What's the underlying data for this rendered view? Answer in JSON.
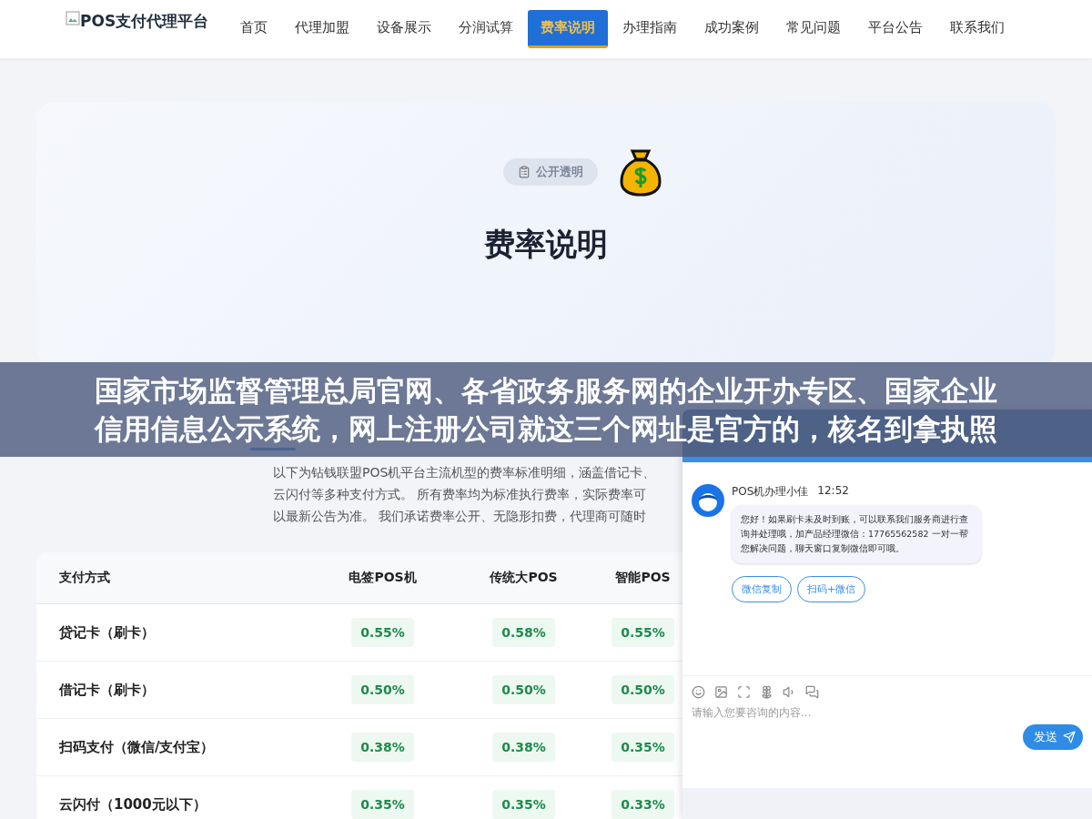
{
  "logo": {
    "alt": "POS支付代理平台"
  },
  "nav": [
    {
      "label": "首页",
      "selected": false
    },
    {
      "label": "代理加盟",
      "selected": false
    },
    {
      "label": "设备展示",
      "selected": false
    },
    {
      "label": "分润试算",
      "selected": false
    },
    {
      "label": "费率说明",
      "selected": true
    },
    {
      "label": "办理指南",
      "selected": false
    },
    {
      "label": "成功案例",
      "selected": false
    },
    {
      "label": "常见问题",
      "selected": false
    },
    {
      "label": "平台公告",
      "selected": false
    },
    {
      "label": "联系我们",
      "selected": false
    }
  ],
  "hero": {
    "badge": "公开透明",
    "title": "费率说明"
  },
  "intro": [
    "以下为钻钱联盟POS机平台主流机型的费率标准明细，涵盖借记卡、",
    "云闪付等多种支付方式。 所有费率均为标准执行费率，实际费率可",
    "以最新公告为准。 我们承诺费率公开、无隐形扣费，代理商可随时"
  ],
  "table": {
    "columns": [
      "支付方式",
      "电签POS机",
      "传统大POS",
      "智能POS"
    ],
    "rows": [
      {
        "method": "贷记卡（刷卡）",
        "rates": [
          "0.55%",
          "0.58%",
          "0.55%"
        ]
      },
      {
        "method": "借记卡（刷卡）",
        "rates": [
          "0.50%",
          "0.50%",
          "0.50%"
        ]
      },
      {
        "method": "扫码支付（微信/支付宝）",
        "rates": [
          "0.38%",
          "0.38%",
          "0.35%"
        ]
      },
      {
        "method": "云闪付（1000元以下）",
        "rates": [
          "0.35%",
          "0.35%",
          "0.33%"
        ]
      }
    ]
  },
  "banner": [
    "国家市场监督管理总局官网、各省政务服务网的企业开办专区、国家企业",
    "信用信息公示系统，网上注册公司就这三个网址是官方的，核名到拿执照"
  ],
  "chat": {
    "sender": "POS机办理小佳",
    "time": "12:52",
    "message": "您好！如果刷卡未及时到账，可以联系我们服务商进行查询并处理哦，加产品经理微信：17765562582 一对一帮您解决问题，聊天窗口复制微信即可哦。",
    "actions": [
      "微信复制",
      "扫码+微信"
    ],
    "placeholder": "请输入您要咨询的内容...",
    "send": "发送"
  }
}
